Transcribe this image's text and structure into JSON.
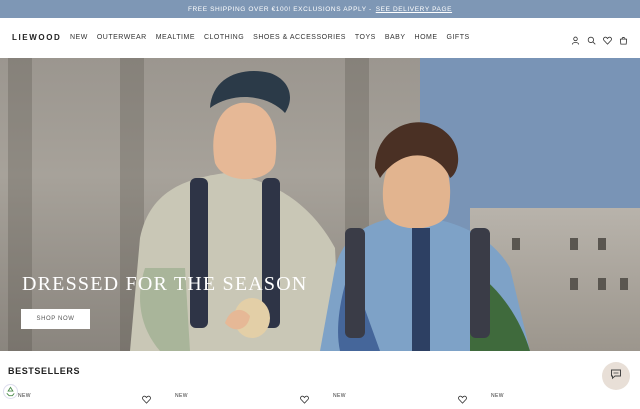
{
  "promo": {
    "text": "FREE SHIPPING OVER €100! EXCLUSIONS APPLY -",
    "link": "SEE DELIVERY PAGE"
  },
  "header": {
    "logo": "LIEWOOD",
    "nav": [
      "NEW",
      "OUTERWEAR",
      "MEALTIME",
      "CLOTHING",
      "SHOES & ACCESSORIES",
      "TOYS",
      "BABY",
      "HOME",
      "GIFTS"
    ],
    "icons": [
      "user-icon",
      "search-icon",
      "heart-icon",
      "cart-icon"
    ]
  },
  "hero": {
    "title": "DRESSED FOR THE SEASON",
    "cta": "SHOP NOW"
  },
  "section": {
    "title": "BESTSELLERS"
  },
  "products": {
    "badges": [
      "NEW",
      "NEW",
      "NEW",
      "NEW"
    ]
  },
  "colors": {
    "promo_bg": "#7e97b5",
    "chat_bg": "#e8dfd7"
  }
}
